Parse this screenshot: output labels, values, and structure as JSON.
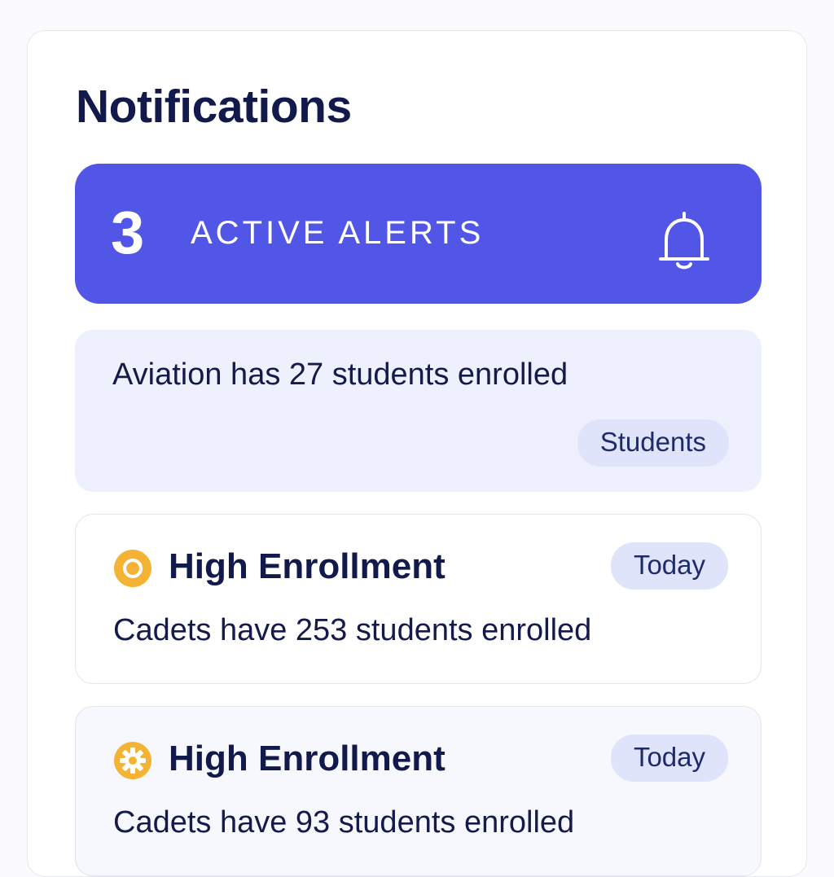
{
  "page": {
    "title": "Notifications"
  },
  "alerts": {
    "count": "3",
    "label": "ACTIVE ALERTS",
    "icon": "bell-icon",
    "color": "#5256e6"
  },
  "info": {
    "text": "Aviation has 27 students enrolled",
    "tag": "Students"
  },
  "notifications": [
    {
      "title": "High Enrollment",
      "date": "Today",
      "body": "Cadets have 253 students enrolled",
      "icon": "warning-dot-icon",
      "icon_color": "#f5b335"
    },
    {
      "title": "High Enrollment",
      "date": "Today",
      "body": "Cadets have 93 students enrolled",
      "icon": "warning-gear-icon",
      "icon_color": "#f5b335"
    }
  ]
}
